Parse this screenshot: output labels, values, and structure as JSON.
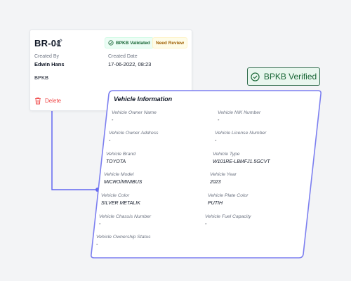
{
  "record": {
    "id": "BR-01",
    "badges": {
      "validated": "BPKB Validated",
      "need_review": "Need Review"
    },
    "created_by_label": "Created By",
    "created_by_value": "Edwin Hans",
    "created_date_label": "Created Date",
    "created_date_value": "17-06-2022, 08:23",
    "document_type": "BPKB",
    "delete_label": "Delete"
  },
  "verified_tag": {
    "label": "BPKB Verified"
  },
  "vehicle_info": {
    "title": "Vehicle Information",
    "fields": {
      "owner_name": {
        "label": "Vehicle Owner Name",
        "value": "-"
      },
      "nik_number": {
        "label": "Vehicle NIK Number",
        "value": "-"
      },
      "owner_address": {
        "label": "Vehicle Owner Address",
        "value": "-"
      },
      "license_number": {
        "label": "Vehicle License Number",
        "value": "-"
      },
      "brand": {
        "label": "Vehicle Brand",
        "value": "TOYOTA"
      },
      "type": {
        "label": "Vehicle Type",
        "value": "W101RE-LBMFJ1.5GCVT"
      },
      "model": {
        "label": "Vehicle Model",
        "value": "MICRO/MINIBUS"
      },
      "year": {
        "label": "Vehicle Year",
        "value": "2023"
      },
      "color": {
        "label": "Vehicle Color",
        "value": "SILVER METALIK"
      },
      "plate_color": {
        "label": "Vehicle Plate Color",
        "value": "PUTIH"
      },
      "chassis_number": {
        "label": "Vehicle Chassis Number",
        "value": "-"
      },
      "fuel_capacity": {
        "label": "Vehicle Fuel Capacity",
        "value": "-"
      },
      "ownership_status": {
        "label": "Vehicle Ownership Status",
        "value": "-"
      }
    }
  },
  "colors": {
    "accent": "#6366f1",
    "verified_green": "#166534",
    "delete_red": "#ef4444",
    "warning_yellow": "#a16207"
  },
  "icons": [
    "edit-pencil-icon",
    "check-circle-icon",
    "trash-icon"
  ]
}
